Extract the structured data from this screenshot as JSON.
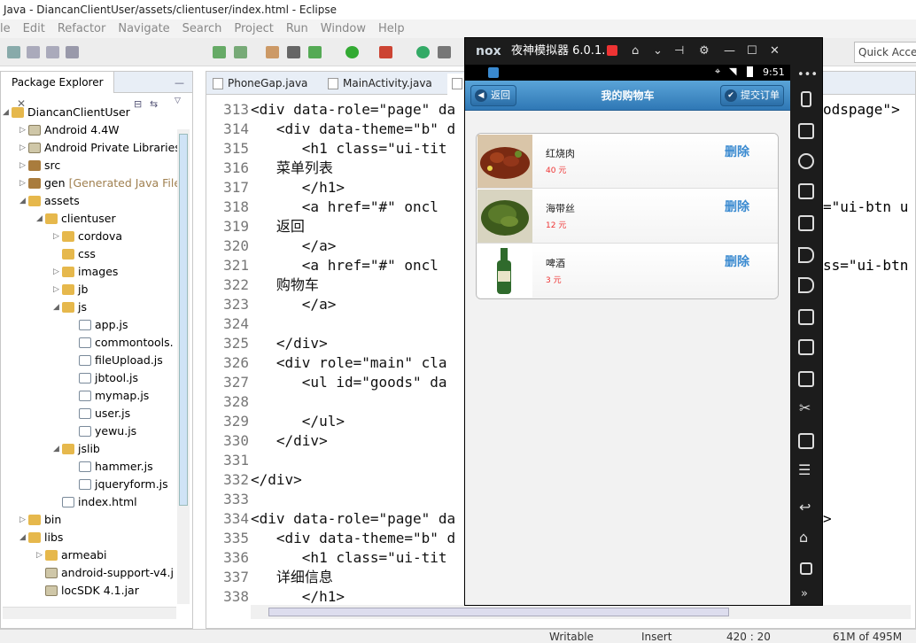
{
  "window": {
    "title": "Java - DiancanClientUser/assets/clientuser/index.html - Eclipse"
  },
  "menu": [
    "le",
    "Edit",
    "Refactor",
    "Navigate",
    "Search",
    "Project",
    "Run",
    "Window",
    "Help"
  ],
  "quick_access": "Quick Acce",
  "package_explorer": {
    "title": "Package Explorer",
    "items": [
      {
        "label": "DiancanClientUser",
        "depth": 0,
        "icon": "project-icon",
        "expanded": true
      },
      {
        "label": "Android 4.4W",
        "depth": 1,
        "icon": "library-icon",
        "expanded": false
      },
      {
        "label": "Android Private Libraries",
        "depth": 1,
        "icon": "library-icon",
        "expanded": false
      },
      {
        "label": "src",
        "depth": 1,
        "icon": "source-folder-icon",
        "expanded": false
      },
      {
        "label": "gen",
        "suffix": "[Generated Java File",
        "depth": 1,
        "icon": "source-folder-icon",
        "expanded": false
      },
      {
        "label": "assets",
        "depth": 1,
        "icon": "folder-icon",
        "expanded": true
      },
      {
        "label": "clientuser",
        "depth": 2,
        "icon": "folder-icon",
        "expanded": true
      },
      {
        "label": "cordova",
        "depth": 3,
        "icon": "folder-icon",
        "expanded": false
      },
      {
        "label": "css",
        "depth": 3,
        "icon": "folder-icon",
        "expanded": null
      },
      {
        "label": "images",
        "depth": 3,
        "icon": "folder-icon",
        "expanded": false
      },
      {
        "label": "jb",
        "depth": 3,
        "icon": "folder-icon",
        "expanded": false
      },
      {
        "label": "js",
        "depth": 3,
        "icon": "folder-icon",
        "expanded": true
      },
      {
        "label": "app.js",
        "depth": 4,
        "icon": "js-file-icon",
        "expanded": null
      },
      {
        "label": "commontools.",
        "depth": 4,
        "icon": "js-file-icon",
        "expanded": null
      },
      {
        "label": "fileUpload.js",
        "depth": 4,
        "icon": "js-file-icon",
        "expanded": null
      },
      {
        "label": "jbtool.js",
        "depth": 4,
        "icon": "js-file-icon",
        "expanded": null
      },
      {
        "label": "mymap.js",
        "depth": 4,
        "icon": "js-file-icon",
        "expanded": null
      },
      {
        "label": "user.js",
        "depth": 4,
        "icon": "js-file-icon",
        "expanded": null
      },
      {
        "label": "yewu.js",
        "depth": 4,
        "icon": "js-file-icon",
        "expanded": null
      },
      {
        "label": "jslib",
        "depth": 3,
        "icon": "folder-icon",
        "expanded": true
      },
      {
        "label": "hammer.js",
        "depth": 4,
        "icon": "js-file-icon",
        "expanded": null
      },
      {
        "label": "jqueryform.js",
        "depth": 4,
        "icon": "js-file-icon",
        "expanded": null
      },
      {
        "label": "index.html",
        "depth": 3,
        "icon": "html-file-icon",
        "expanded": null
      },
      {
        "label": "bin",
        "depth": 1,
        "icon": "folder-icon",
        "expanded": false
      },
      {
        "label": "libs",
        "depth": 1,
        "icon": "folder-icon",
        "expanded": true
      },
      {
        "label": "armeabi",
        "depth": 2,
        "icon": "folder-icon",
        "expanded": false
      },
      {
        "label": "android-support-v4.j",
        "depth": 2,
        "icon": "jar-icon",
        "expanded": null
      },
      {
        "label": "locSDK 4.1.jar",
        "depth": 2,
        "icon": "jar-icon",
        "expanded": null
      }
    ]
  },
  "editor": {
    "tabs": [
      "PhoneGap.java",
      "MainActivity.java"
    ],
    "lines": [
      {
        "n": "313",
        "text": "<div data-role=\"page\" da"
      },
      {
        "n": "314",
        "text": "   <div data-theme=\"b\" d"
      },
      {
        "n": "315",
        "text": "      <h1 class=\"ui-tit"
      },
      {
        "n": "316",
        "text": "   菜单列表"
      },
      {
        "n": "317",
        "text": "      </h1>"
      },
      {
        "n": "318",
        "text": "      <a href=\"#\" oncl"
      },
      {
        "n": "319",
        "text": "   返回"
      },
      {
        "n": "320",
        "text": "      </a>"
      },
      {
        "n": "321",
        "text": "      <a href=\"#\" oncl"
      },
      {
        "n": "322",
        "text": "   购物车"
      },
      {
        "n": "323",
        "text": "      </a>"
      },
      {
        "n": "324",
        "text": ""
      },
      {
        "n": "325",
        "text": "   </div>"
      },
      {
        "n": "326",
        "text": "   <div role=\"main\" cla"
      },
      {
        "n": "327",
        "text": "      <ul id=\"goods\" da"
      },
      {
        "n": "328",
        "text": ""
      },
      {
        "n": "329",
        "text": "      </ul>"
      },
      {
        "n": "330",
        "text": "   </div>"
      },
      {
        "n": "331",
        "text": ""
      },
      {
        "n": "332",
        "text": "</div>"
      },
      {
        "n": "333",
        "text": ""
      },
      {
        "n": "334",
        "text": "<div data-role=\"page\" da"
      },
      {
        "n": "335",
        "text": "   <div data-theme=\"b\" d"
      },
      {
        "n": "336",
        "text": "      <h1 class=\"ui-tit"
      },
      {
        "n": "337",
        "text": "   详细信息"
      },
      {
        "n": "338",
        "text": "      </h1>"
      }
    ],
    "right_fragments": [
      {
        "line": "313",
        "text": "odspage\">"
      },
      {
        "line": "318",
        "text": "=\"ui-btn u"
      },
      {
        "line": "321",
        "text": "ss=\"ui-btn"
      },
      {
        "line": "334",
        "text": ">"
      }
    ]
  },
  "status": {
    "writable": "Writable",
    "insert": "Insert",
    "position": "420 : 20",
    "memory": "61M of 495M"
  },
  "emulator": {
    "brand": "nox",
    "title": "夜神模拟器 6.0.1.",
    "time": "9:51",
    "app": {
      "back_label": "返回",
      "page_title": "我的购物车",
      "submit_label": "提交订单",
      "items": [
        {
          "name": "红烧肉",
          "price": "40 元",
          "delete": "删除"
        },
        {
          "name": "海带丝",
          "price": "12 元",
          "delete": "删除"
        },
        {
          "name": "啤酒",
          "price": "3 元",
          "delete": "删除"
        }
      ]
    }
  },
  "colors": {
    "accent": "#2f78b5",
    "price": "#e33333",
    "delete": "#3a8ad0"
  }
}
